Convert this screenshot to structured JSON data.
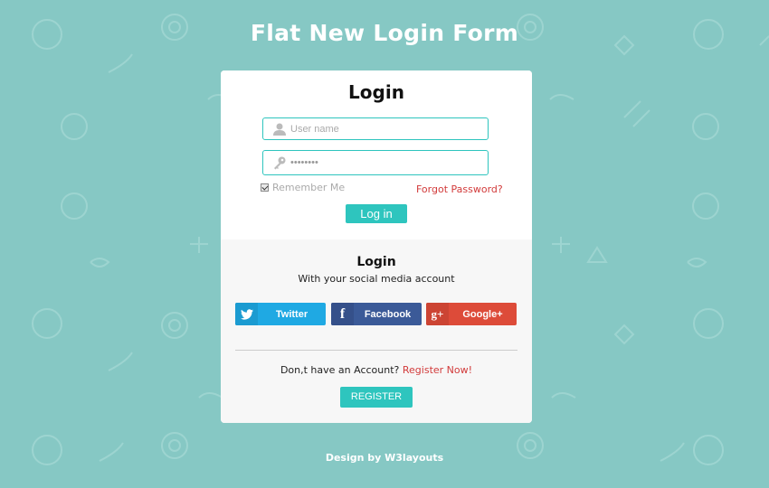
{
  "page": {
    "title": "Flat New Login Form",
    "background_color": "#86c8c4",
    "accent_color": "#2ec5be",
    "link_color": "#d23b3b"
  },
  "login": {
    "heading": "Login",
    "username": {
      "placeholder": "User name",
      "value": "",
      "icon": "user-icon"
    },
    "password": {
      "value": "••••••••",
      "icon": "key-icon"
    },
    "remember_me": {
      "label": "Remember Me",
      "checked": true
    },
    "forgot_password": "Forgot Password?",
    "submit_label": "Log in"
  },
  "social": {
    "heading": "Login",
    "subtitle": "With your social media account",
    "buttons": [
      {
        "label": "Twitter",
        "icon": "twitter-bird-icon",
        "glyph": "",
        "color": "#1fa9e3"
      },
      {
        "label": "Facebook",
        "icon": "facebook-f-icon",
        "glyph": "f",
        "color": "#3b5a98"
      },
      {
        "label": "Google+",
        "icon": "google-plus-icon",
        "glyph": "g+",
        "color": "#dd4b39"
      }
    ]
  },
  "account": {
    "prompt": "Don,t have an Account?",
    "register_link": "Register Now!",
    "register_button": "REGISTER"
  },
  "footer": {
    "text": "Design by W3layouts"
  }
}
